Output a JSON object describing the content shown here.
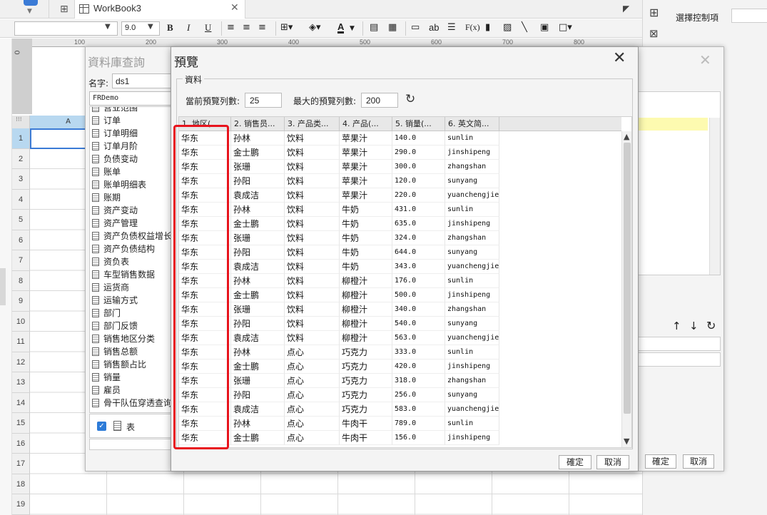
{
  "app": {
    "tab_title": "WorkBook3",
    "font_size": "9.0"
  },
  "toolbar": {
    "bold": "B",
    "italic": "I",
    "underline": "U",
    "text_label": "ab",
    "formula_label": "F(x)",
    "font_color_label": "A"
  },
  "right_panel": {
    "label": "選擇控制項"
  },
  "ruler": {
    "zero": "0",
    "ticks": [
      "100",
      "200",
      "300",
      "400",
      "500",
      "600",
      "700",
      "800"
    ]
  },
  "sheet": {
    "column_a": "A",
    "rows": [
      "1",
      "2",
      "3",
      "4",
      "5",
      "6",
      "7",
      "8",
      "9",
      "10",
      "11",
      "12",
      "13",
      "14",
      "15",
      "16",
      "17",
      "18",
      "19"
    ]
  },
  "db_query": {
    "title": "資料庫查詢",
    "name_label": "名字:",
    "name_value": "ds1",
    "datasource": "FRDemo",
    "tables": [
      "营业范围",
      "订单",
      "订单明细",
      "订单月阶",
      "负债变动",
      "账单",
      "账单明细表",
      "账期",
      "资产变动",
      "资产管理",
      "资产负债权益增长",
      "资产负债结构",
      "资负表",
      "车型销售数据",
      "运货商",
      "运输方式",
      "部门",
      "部门反馈",
      "销售地区分类",
      "销售总额",
      "销售额占比",
      "销量",
      "雇员",
      "骨干队伍穿透查询"
    ],
    "type_label": "表",
    "ok": "確定",
    "cancel": "取消"
  },
  "preview": {
    "title": "預覽",
    "group_label": "資料",
    "current_rows_label": "當前預覽列數:",
    "current_rows": "25",
    "max_rows_label": "最大的預覽列數:",
    "max_rows": "200",
    "ok": "確定",
    "cancel": "取消",
    "columns": [
      "1. 地区(...",
      "2. 销售员...",
      "3. 产品类...",
      "4. 产品(...",
      "5. 销量(...",
      "6. 英文简..."
    ],
    "rows": [
      [
        "华东",
        "孙林",
        "饮料",
        "苹果汁",
        "140.0",
        "sunlin"
      ],
      [
        "华东",
        "金士鹏",
        "饮料",
        "苹果汁",
        "290.0",
        "jinshipeng"
      ],
      [
        "华东",
        "张珊",
        "饮料",
        "苹果汁",
        "300.0",
        "zhangshan"
      ],
      [
        "华东",
        "孙阳",
        "饮料",
        "苹果汁",
        "120.0",
        "sunyang"
      ],
      [
        "华东",
        "袁成洁",
        "饮料",
        "苹果汁",
        "220.0",
        "yuanchengjie"
      ],
      [
        "华东",
        "孙林",
        "饮料",
        "牛奶",
        "431.0",
        "sunlin"
      ],
      [
        "华东",
        "金士鹏",
        "饮料",
        "牛奶",
        "635.0",
        "jinshipeng"
      ],
      [
        "华东",
        "张珊",
        "饮料",
        "牛奶",
        "324.0",
        "zhangshan"
      ],
      [
        "华东",
        "孙阳",
        "饮料",
        "牛奶",
        "644.0",
        "sunyang"
      ],
      [
        "华东",
        "袁成洁",
        "饮料",
        "牛奶",
        "343.0",
        "yuanchengjie"
      ],
      [
        "华东",
        "孙林",
        "饮料",
        "柳橙汁",
        "176.0",
        "sunlin"
      ],
      [
        "华东",
        "金士鹏",
        "饮料",
        "柳橙汁",
        "500.0",
        "jinshipeng"
      ],
      [
        "华东",
        "张珊",
        "饮料",
        "柳橙汁",
        "340.0",
        "zhangshan"
      ],
      [
        "华东",
        "孙阳",
        "饮料",
        "柳橙汁",
        "540.0",
        "sunyang"
      ],
      [
        "华东",
        "袁成洁",
        "饮料",
        "柳橙汁",
        "563.0",
        "yuanchengjie"
      ],
      [
        "华东",
        "孙林",
        "点心",
        "巧克力",
        "333.0",
        "sunlin"
      ],
      [
        "华东",
        "金士鹏",
        "点心",
        "巧克力",
        "420.0",
        "jinshipeng"
      ],
      [
        "华东",
        "张珊",
        "点心",
        "巧克力",
        "318.0",
        "zhangshan"
      ],
      [
        "华东",
        "孙阳",
        "点心",
        "巧克力",
        "256.0",
        "sunyang"
      ],
      [
        "华东",
        "袁成洁",
        "点心",
        "巧克力",
        "583.0",
        "yuanchengjie"
      ],
      [
        "华东",
        "孙林",
        "点心",
        "牛肉干",
        "789.0",
        "sunlin"
      ],
      [
        "华东",
        "金士鹏",
        "点心",
        "牛肉干",
        "156.0",
        "jinshipeng"
      ]
    ]
  },
  "colors": {
    "highlight_box": "#e8141d",
    "selection_blue": "#3b7bd6",
    "checkbox_blue": "#2d7bd8"
  }
}
